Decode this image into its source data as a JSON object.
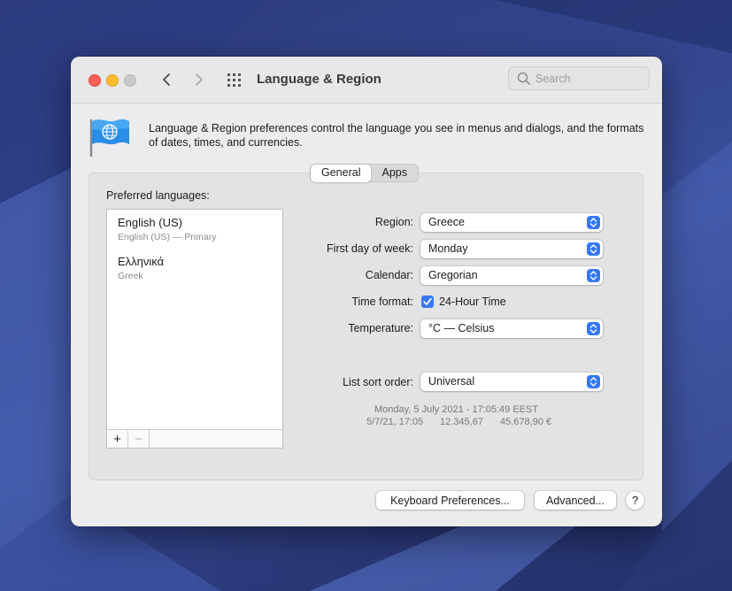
{
  "window": {
    "title": "Language & Region",
    "search_placeholder": "Search"
  },
  "description": "Language & Region preferences control the language you see in menus and dialogs, and the formats of dates, times, and currencies.",
  "tabs": [
    {
      "label": "General",
      "active": true
    },
    {
      "label": "Apps",
      "active": false
    }
  ],
  "preferred_languages": {
    "label": "Preferred languages:",
    "items": [
      {
        "name": "English (US)",
        "subtitle": "English (US) — Primary"
      },
      {
        "name": "Ελληνικά",
        "subtitle": "Greek"
      }
    ],
    "add_label": "+",
    "remove_label": "−"
  },
  "settings": {
    "region": {
      "label": "Region:",
      "value": "Greece"
    },
    "first_day": {
      "label": "First day of week:",
      "value": "Monday"
    },
    "calendar": {
      "label": "Calendar:",
      "value": "Gregorian"
    },
    "time_format": {
      "label": "Time format:",
      "checkbox_label": "24-Hour Time",
      "checked": true
    },
    "temperature": {
      "label": "Temperature:",
      "value": "°C — Celsius"
    },
    "sort_order": {
      "label": "List sort order:",
      "value": "Universal"
    }
  },
  "sample": {
    "date_line": "Monday, 5 July 2021 - 17:05:49 EEST",
    "short_date": "5/7/21, 17:05",
    "number": "12.345,67",
    "currency": "45.678,90 €"
  },
  "buttons": {
    "keyboard": "Keyboard Preferences...",
    "advanced": "Advanced...",
    "help": "?"
  },
  "colors": {
    "accent": "#3478f6",
    "close": "#fe5f57",
    "minimize": "#febc2e"
  }
}
